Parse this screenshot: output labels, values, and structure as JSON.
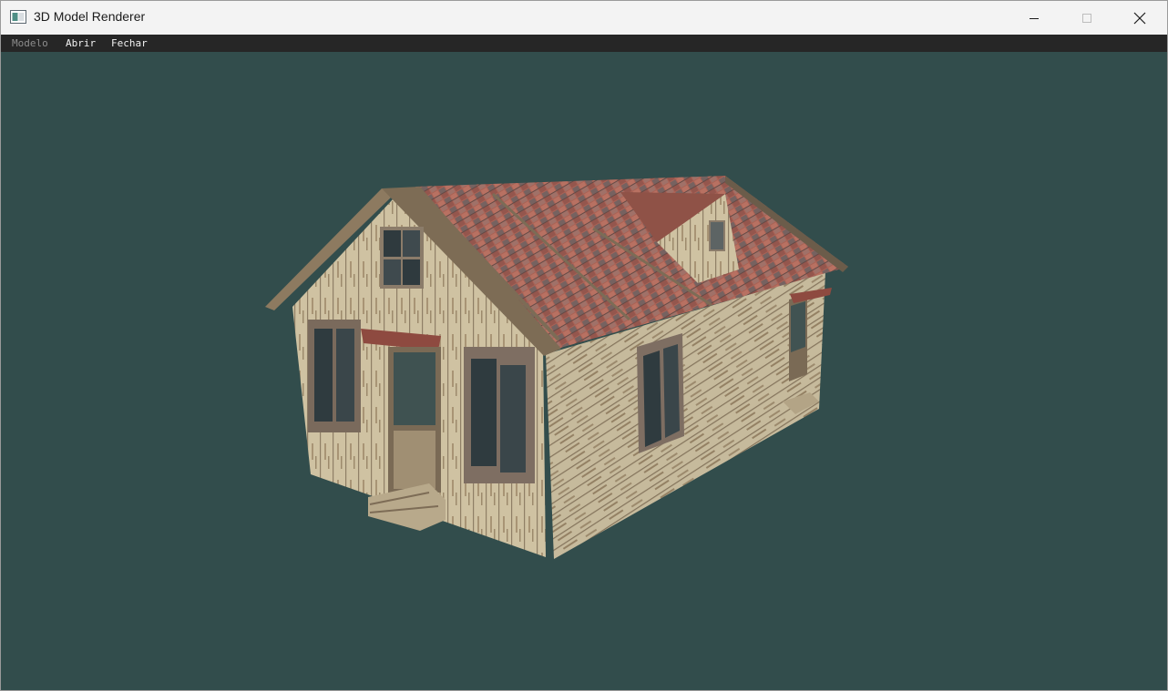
{
  "window": {
    "title": "3D Model Renderer",
    "controls": {
      "minimize": "minimize-icon",
      "maximize": "maximize-icon",
      "close": "close-icon"
    }
  },
  "menubar": {
    "items": [
      {
        "label": "Modelo",
        "enabled": false
      },
      {
        "label": "Abrir",
        "enabled": true
      },
      {
        "label": "Fechar",
        "enabled": true
      }
    ]
  },
  "viewport": {
    "background": "#324d4c",
    "model": "textured wooden house with tiled roof"
  },
  "colors": {
    "menubar_bg": "#262626",
    "titlebar_bg": "#f3f3f3",
    "wall": "#cdbf9e",
    "roof": "#a45a4c"
  }
}
